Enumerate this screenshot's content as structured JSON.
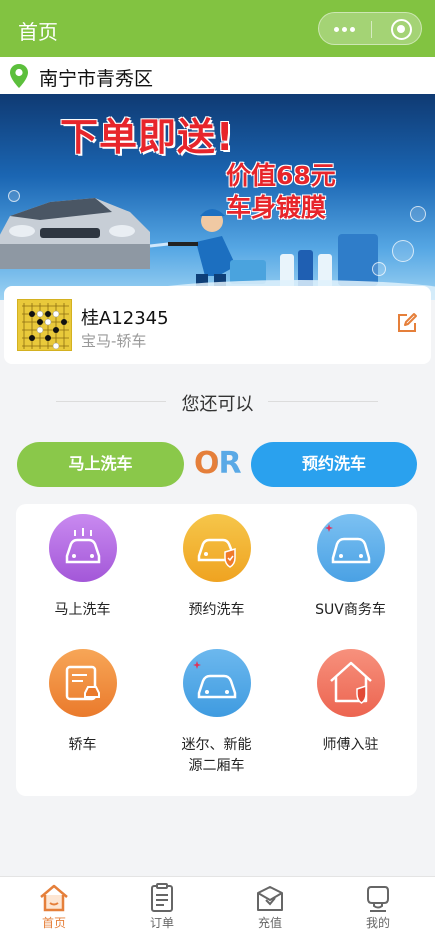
{
  "header": {
    "title": "首页"
  },
  "location": {
    "city": "南宁市青秀区"
  },
  "banner": {
    "title": "下单即送!",
    "line1": "价值68元",
    "line2": "车身镀膜"
  },
  "car": {
    "plate": "桂A12345",
    "model": "宝马-轿车"
  },
  "section": {
    "title": "您还可以"
  },
  "actions": {
    "wash_now": "马上洗车",
    "or": "OR",
    "book": "预约洗车"
  },
  "services": [
    {
      "label": "马上洗车",
      "icon": "car-wash-icon",
      "color": "#b66be0"
    },
    {
      "label": "预约洗车",
      "icon": "car-shield-icon",
      "color": "#f3b22c"
    },
    {
      "label": "SUV商务车",
      "icon": "suv-icon",
      "color": "#5aaee9"
    },
    {
      "label": "轿车",
      "icon": "sedan-icon",
      "color": "#f08a3c"
    },
    {
      "label": "迷尔、新能源二厢车",
      "icon": "hatchback-icon",
      "color": "#4ca9e6"
    },
    {
      "label": "师傅入驻",
      "icon": "house-shield-icon",
      "color": "#f0715e"
    }
  ],
  "tabbar": [
    {
      "label": "首页",
      "icon": "home-icon",
      "active": true
    },
    {
      "label": "订单",
      "icon": "order-icon",
      "active": false
    },
    {
      "label": "充值",
      "icon": "recharge-icon",
      "active": false
    },
    {
      "label": "我的",
      "icon": "profile-icon",
      "active": false
    }
  ],
  "colors": {
    "primary": "#82c341",
    "accent": "#e57f3a",
    "blue": "#2aa1ee"
  }
}
